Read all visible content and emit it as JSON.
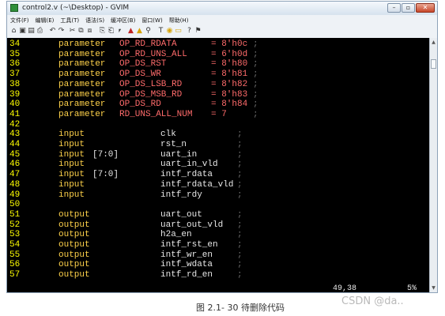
{
  "window": {
    "title": "control2.v (~\\Desktop) - GVIM",
    "buttons": [
      "–",
      "▫",
      "✕"
    ]
  },
  "menubar": [
    "文件(F)",
    "编辑(E)",
    "工具(T)",
    "语法(S)",
    "缓冲区(B)",
    "窗口(W)",
    "帮助(H)"
  ],
  "toolbar": {
    "icons": [
      "open-icon",
      "save-icon",
      "save-all-icon",
      "print-icon",
      "undo-icon",
      "redo-icon",
      "cut-icon",
      "copy-icon",
      "paste-icon",
      "find-icon",
      "find-next-icon",
      "find-prev-icon",
      "load-session-icon",
      "save-session-icon",
      "run-script-icon",
      "make-icon",
      "tag-icon",
      "tag-jump-icon",
      "help-icon",
      "find-help-icon"
    ],
    "glyphs": [
      "⌂",
      "▣",
      "▤",
      "⎙",
      "↶",
      "↷",
      "✂",
      "⧉",
      "⧈",
      "⎘",
      "⎗",
      "⎖",
      "▲",
      "▲",
      "⚲",
      "T",
      "◉",
      "▭",
      "?",
      "⚑"
    ]
  },
  "editor": {
    "lines": [
      {
        "n": "34",
        "a": "parameter",
        "b": "OP_RD_RDATA",
        "c": "= 8'h0c",
        "d": ";"
      },
      {
        "n": "35",
        "a": "parameter",
        "b": "OP_RD_UNS_ALL",
        "c": "= 6'h0d",
        "d": ";"
      },
      {
        "n": "36",
        "a": "parameter",
        "b": "OP_DS_RST",
        "c": "= 8'h80",
        "d": ";"
      },
      {
        "n": "37",
        "a": "parameter",
        "b": "OP_DS_WR",
        "c": "= 8'h81",
        "d": ";"
      },
      {
        "n": "38",
        "a": "parameter",
        "b": "OP_DS_LSB_RD",
        "c": "= 8'h82",
        "d": ";"
      },
      {
        "n": "39",
        "a": "parameter",
        "b": "OP_DS_MSB_RD",
        "c": "= 8'h83",
        "d": ";"
      },
      {
        "n": "40",
        "a": "parameter",
        "b": "OP_DS_RD",
        "c": "= 8'h84",
        "d": ";"
      },
      {
        "n": "41",
        "a": "parameter",
        "b": "RD_UNS_ALL_NUM",
        "c": "= 7",
        "d": ";"
      },
      {
        "n": "42",
        "a": "",
        "b": "",
        "c": "",
        "d": ""
      },
      {
        "n": "43",
        "a": "input",
        "w": "",
        "p": "clk",
        "d": ";"
      },
      {
        "n": "44",
        "a": "input",
        "w": "",
        "p": "rst_n",
        "d": ";"
      },
      {
        "n": "45",
        "a": "input",
        "w": "[7:0]",
        "p": "uart_in",
        "d": ";"
      },
      {
        "n": "46",
        "a": "input",
        "w": "",
        "p": "uart_in_vld",
        "d": ";"
      },
      {
        "n": "47",
        "a": "input",
        "w": "[7:0]",
        "p": "intf_rdata",
        "d": ";"
      },
      {
        "n": "48",
        "a": "input",
        "w": "",
        "p": "intf_rdata_vld",
        "d": ";"
      },
      {
        "n": "49",
        "a": "input",
        "w": "",
        "p": "intf_rdy",
        "d": ";"
      },
      {
        "n": "50",
        "a": "",
        "b": "",
        "c": "",
        "d": ""
      },
      {
        "n": "51",
        "a": "output",
        "w": "",
        "p": "uart_out",
        "d": ";"
      },
      {
        "n": "52",
        "a": "output",
        "w": "",
        "p": "uart_out_vld",
        "d": ";"
      },
      {
        "n": "53",
        "a": "output",
        "w": "",
        "p": "h2a_en",
        "d": ";"
      },
      {
        "n": "54",
        "a": "output",
        "w": "",
        "p": "intf_rst_en",
        "d": ";"
      },
      {
        "n": "55",
        "a": "output",
        "w": "",
        "p": "intf_wr_en",
        "d": ";"
      },
      {
        "n": "56",
        "a": "output",
        "w": "",
        "p": "intf_wdata",
        "d": ";"
      },
      {
        "n": "57",
        "a": "output",
        "w": "",
        "p": "intf_rd_en",
        "d": ";"
      }
    ],
    "cursor_position": "49,38",
    "scroll_percent": "5%"
  },
  "caption": "图 2.1- 30 待删除代码",
  "watermark": "CSDN @da.."
}
